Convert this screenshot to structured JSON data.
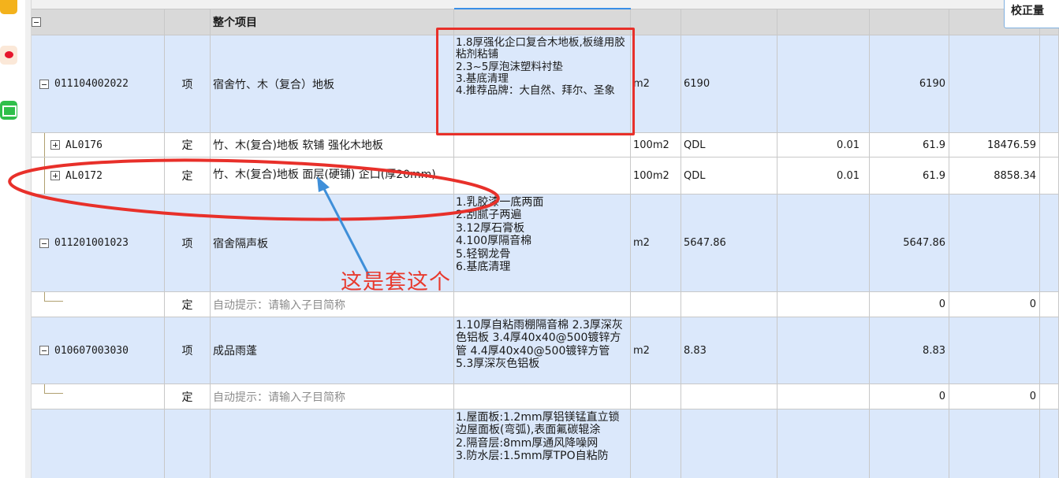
{
  "popup": {
    "label": "校正量"
  },
  "project_row": {
    "title": "整个项目"
  },
  "rows": [
    {
      "code": "011104002022",
      "type": "项",
      "name": "宿舍竹、木（复合）地板",
      "desc": "1.8厚强化企口复合木地板,板缝用胶粘剂粘铺\n2.3~5厚泡沫塑料衬垫\n3.基底清理\n4.推荐品牌：大自然、拜尔、圣象",
      "unit": "m2",
      "qty": "6190",
      "coef": "",
      "total": "6190",
      "price": ""
    },
    {
      "code": "AL0176",
      "type": "定",
      "name": "竹、木(复合)地板 软铺 强化木地板",
      "desc": "",
      "unit": "100m2",
      "qty": "QDL",
      "coef": "0.01",
      "total": "61.9",
      "price": "18476.59"
    },
    {
      "code": "AL0172",
      "type": "定",
      "name": "竹、木(复合)地板 面层(硬铺) 企口(厚20mm)",
      "desc": "",
      "unit": "100m2",
      "qty": "QDL",
      "coef": "0.01",
      "total": "61.9",
      "price": "8858.34"
    },
    {
      "code": "011201001023",
      "type": "项",
      "name": "宿舍隔声板",
      "desc": "1.乳胶漆一底两面\n2.刮腻子两遍\n3.12厚石膏板\n4.100厚隔音棉\n5.轻钢龙骨\n6.基底清理",
      "unit": "m2",
      "qty": "5647.86",
      "coef": "",
      "total": "5647.86",
      "price": ""
    },
    {
      "code": "",
      "type": "定",
      "name": "自动提示：请输入子目简称",
      "desc": "",
      "unit": "",
      "qty": "",
      "coef": "",
      "total": "0",
      "price": "0"
    },
    {
      "code": "010607003030",
      "type": "项",
      "name": "成品雨蓬",
      "desc": "1.10厚自粘雨棚隔音棉 2.3厚深灰色铝板 3.4厚40x40@500镀锌方管 4.4厚40x40@500镀锌方管 5.3厚深灰色铝板",
      "unit": "m2",
      "qty": "8.83",
      "coef": "",
      "total": "8.83",
      "price": ""
    },
    {
      "code": "",
      "type": "定",
      "name": "自动提示：请输入子目简称",
      "desc": "",
      "unit": "",
      "qty": "",
      "coef": "",
      "total": "0",
      "price": "0"
    },
    {
      "code": "",
      "type": "",
      "name": "",
      "desc": "1.屋面板:1.2mm厚铝镁锰直立锁边屋面板(弯弧),表面氟碳辊涂\n2.隔音层:8mm厚通风降噪网\n3.防水层:1.5mm厚TPO自粘防",
      "unit": "",
      "qty": "",
      "coef": "",
      "total": "",
      "price": ""
    }
  ],
  "annotation": {
    "text": "这是套这个"
  }
}
